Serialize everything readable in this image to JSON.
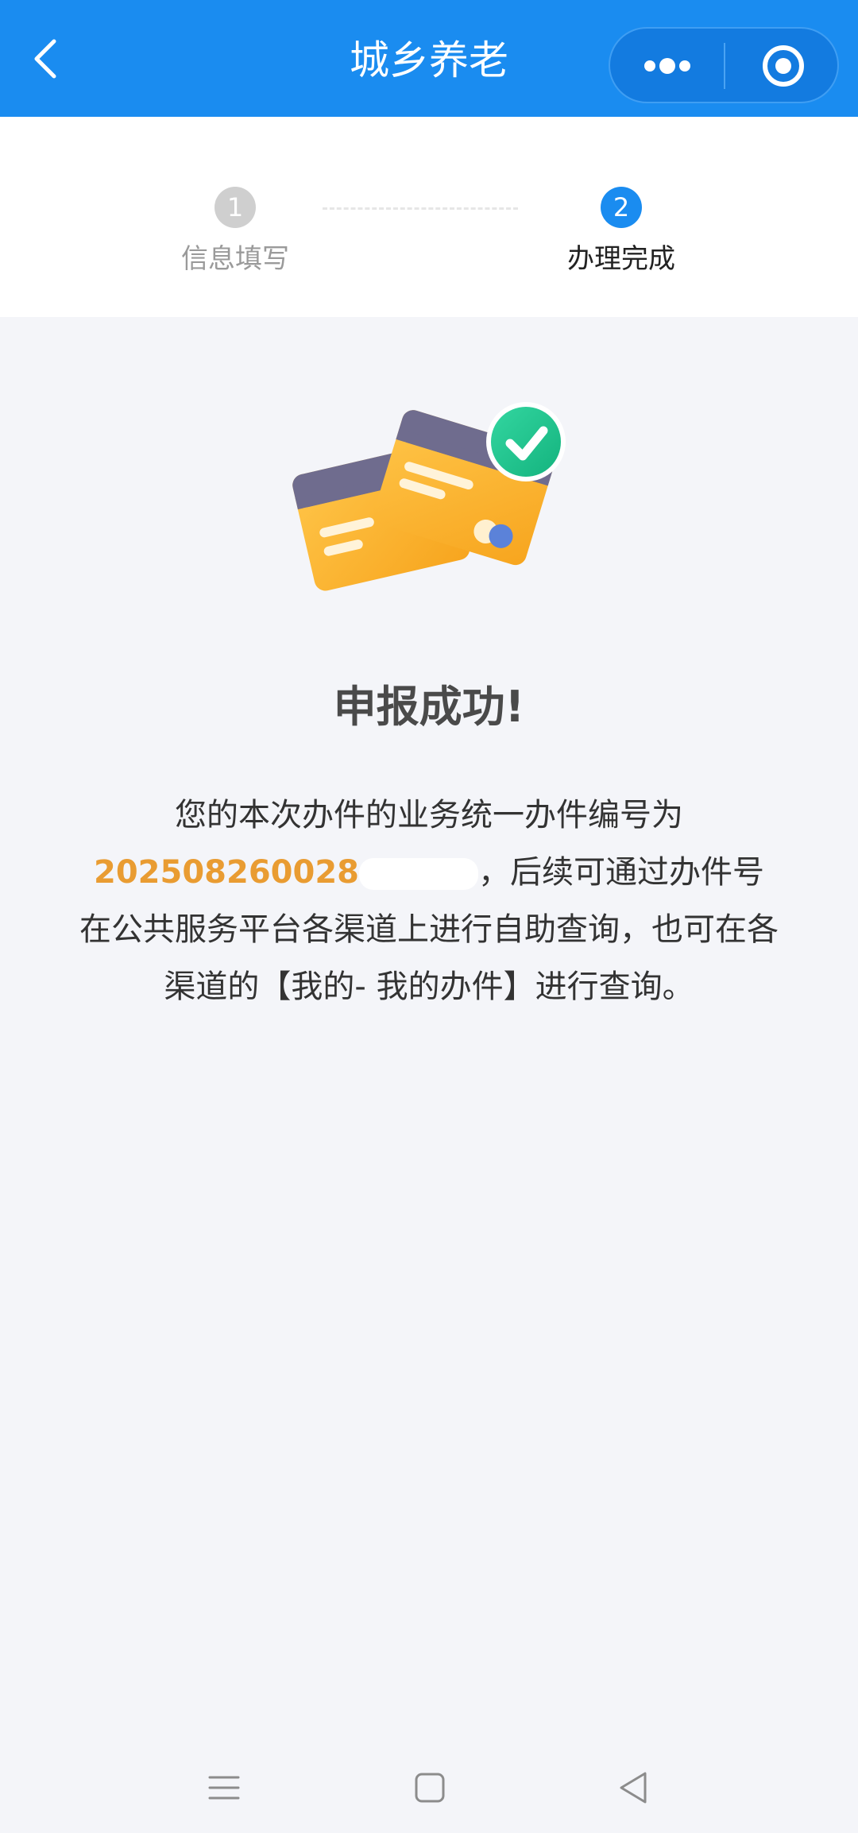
{
  "header": {
    "title": "城乡养老",
    "icons": [
      "back-arrow-icon",
      "more-dots-icon",
      "close-target-icon"
    ],
    "color": "#1a8cf0"
  },
  "steps": [
    {
      "number": "1",
      "label": "信息填写",
      "state": "done"
    },
    {
      "number": "2",
      "label": "办理完成",
      "state": "active"
    }
  ],
  "result": {
    "illustration": "credit-cards-checkmark-icon",
    "title": "申报成功!",
    "desc_part1": "您的本次办件的业务统一办件编号为",
    "code": "202508260028",
    "desc_part2": "，后续可通过办件号在公共服务平台各渠道上进行自助查询，也可在各渠道的【我的- 我的办件】进行查询。",
    "code_color": "#e99c32"
  },
  "system_nav": {
    "icons": [
      "menu-icon",
      "home-square-icon",
      "back-triangle-icon"
    ]
  }
}
